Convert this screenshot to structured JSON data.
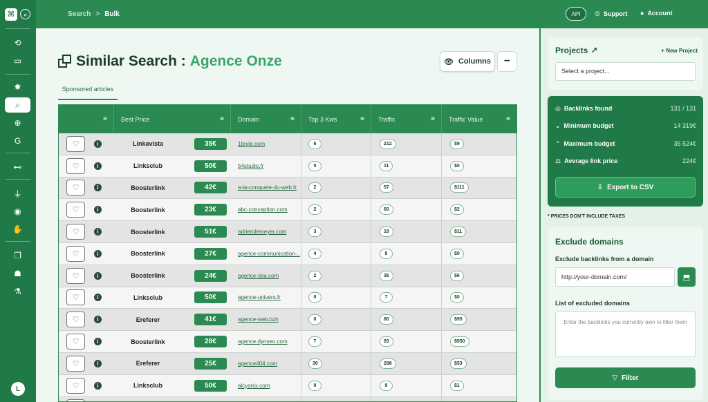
{
  "breadcrumb": {
    "root": "Search",
    "sep": ">",
    "current": "Bulk"
  },
  "topbar": {
    "api": "API",
    "support": "Support",
    "account": "Account"
  },
  "sidebar": {
    "logo": "⌘",
    "expand": "»",
    "avatar": "L",
    "icons": [
      "history-icon",
      "folder-icon",
      "gear-icon",
      "search-icon",
      "crosshair-icon",
      "google-icon",
      "binoculars-icon",
      "plug-icon",
      "chrome-icon",
      "hand-coin-icon",
      "copy-icon",
      "people-icon",
      "flask-icon"
    ]
  },
  "page": {
    "title_prefix": "Similar Search :",
    "title_accent": "Agence Onze",
    "columns_label": "Columns",
    "minus": "−",
    "tab": "Sponsored articles"
  },
  "table": {
    "headers": [
      "Best Price",
      "Domain",
      "Top 3 Kws",
      "Traffic",
      "Traffic Value"
    ],
    "rows": [
      {
        "vendor": "Linkavista",
        "price": "35€",
        "domain": "1texte.com",
        "kws": "6",
        "traffic": "212",
        "value": "$9"
      },
      {
        "vendor": "Linksclub",
        "price": "50€",
        "domain": "54studio.fr",
        "kws": "0",
        "traffic": "11",
        "value": "$0"
      },
      {
        "vendor": "Boosterlink",
        "price": "42€",
        "domain": "a-la-conquete-du-web.fr",
        "kws": "2",
        "traffic": "57",
        "value": "$111"
      },
      {
        "vendor": "Boosterlink",
        "price": "23€",
        "domain": "abc-conception.com",
        "kws": "2",
        "traffic": "60",
        "value": "$2"
      },
      {
        "vendor": "Boosterlink",
        "price": "51€",
        "domain": "adriendemeyer.com",
        "kws": "3",
        "traffic": "19",
        "value": "$11"
      },
      {
        "vendor": "Boosterlink",
        "price": "27€",
        "domain": "agence-communication-...",
        "kws": "4",
        "traffic": "8",
        "value": "$0"
      },
      {
        "vendor": "Boosterlink",
        "price": "24€",
        "domain": "agence-sba.com",
        "kws": "2",
        "traffic": "36",
        "value": "$6"
      },
      {
        "vendor": "Linksclub",
        "price": "50€",
        "domain": "agence-univers.fr",
        "kws": "0",
        "traffic": "7",
        "value": "$0"
      },
      {
        "vendor": "Ereferer",
        "price": "41€",
        "domain": "agence-web.bzh",
        "kws": "0",
        "traffic": "80",
        "value": "$95"
      },
      {
        "vendor": "Boosterlink",
        "price": "28€",
        "domain": "agence.dynseo.com",
        "kws": "7",
        "traffic": "93",
        "value": "$550"
      },
      {
        "vendor": "Ereferer",
        "price": "25€",
        "domain": "agence404.com",
        "kws": "30",
        "traffic": "298",
        "value": "$53"
      },
      {
        "vendor": "Linksclub",
        "price": "50€",
        "domain": "alcyonix.com",
        "kws": "0",
        "traffic": "9",
        "value": "$1"
      },
      {
        "vendor": "",
        "price": "",
        "domain": "",
        "kws": "",
        "traffic": "",
        "value": ""
      }
    ]
  },
  "projects": {
    "title": "Projects",
    "new_label": "New Project",
    "placeholder": "Select a project..."
  },
  "stats": {
    "backlinks_label": "Backlinks found",
    "backlinks_value": "131 / 131",
    "min_label": "Minimum budget",
    "min_value": "14 319€",
    "max_label": "Maximum budget",
    "max_value": "35 524€",
    "avg_label": "Average link price",
    "avg_value": "224€",
    "export_label": "Export to CSV"
  },
  "note": "* PRICES DON'T INCLUDE TAXES",
  "exclude": {
    "title": "Exclude domains",
    "from_label": "Exclude backlinks from a domain",
    "domain_placeholder": "http://your-domain.com/",
    "list_label": "List of excluded domains",
    "list_placeholder": "Enter the backlinks you currently own to filter them",
    "filter_label": "Filter"
  },
  "colors": {
    "primary": "#2b8a52",
    "dark": "#1f7a47",
    "accent": "#3aa46a"
  }
}
